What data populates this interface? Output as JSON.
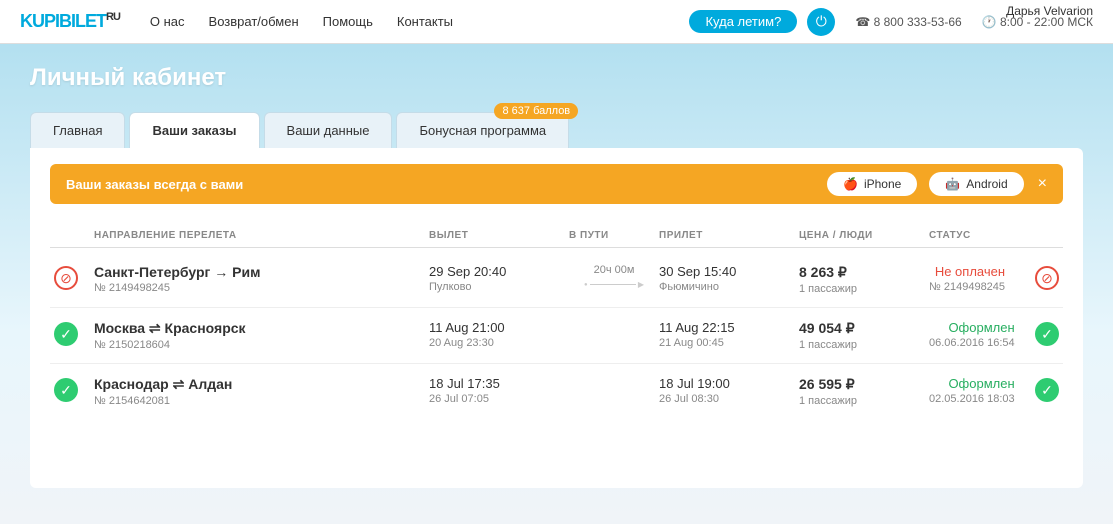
{
  "header": {
    "logo": "KUPIBILET",
    "logo_suffix": "RU",
    "nav": [
      "О нас",
      "Возврат/обмен",
      "Помощь",
      "Контакты"
    ],
    "search_placeholder": "Куда летим?",
    "phone": "8 800 333-53-66",
    "hours": "8:00 - 22:00 МСК",
    "user_name": "Дарья Velvarion"
  },
  "page": {
    "title": "Личный кабинет"
  },
  "tabs": [
    {
      "id": "main",
      "label": "Главная",
      "active": false
    },
    {
      "id": "orders",
      "label": "Ваши заказы",
      "active": true
    },
    {
      "id": "data",
      "label": "Ваши данные",
      "active": false
    },
    {
      "id": "bonus",
      "label": "Бонусная программа",
      "active": false,
      "badge": "8 637  баллов"
    }
  ],
  "app_banner": {
    "text": "Ваши заказы всегда с вами",
    "iphone_label": " iPhone",
    "android_label": " Android",
    "close": "×"
  },
  "table": {
    "columns": [
      "",
      "НАПРАВЛЕНИЕ ПЕРЕЛЕТА",
      "ВЫЛЕТ",
      "В ПУТИ",
      "ПРИЛЕТ",
      "ЦЕНА / ЛЮДИ",
      "СТАТУС"
    ],
    "orders": [
      {
        "status_icon": "cancel",
        "route": "Санкт-Петербург → Рим",
        "order_num": "№ 2149498245",
        "depart_time": "29 Sep 20:40",
        "depart_place": "Пулково",
        "duration": "20ч 00м",
        "arrive_time": "30 Sep 15:40",
        "arrive_place": "Фьюмичино",
        "price": "8 263 ₽",
        "passengers": "1 пассажир",
        "status_text": "Не оплачен",
        "status_type": "not-paid",
        "status_order": "№ 2149498245",
        "status_date": "",
        "status_icon_right": "cancel"
      },
      {
        "status_icon": "ok",
        "route": "Москва ⇌ Красноярск",
        "order_num": "№ 2150218604",
        "depart_time": "11 Aug 21:00",
        "depart_time2": "20 Aug 23:30",
        "depart_place": "",
        "duration": "",
        "arrive_time": "11 Aug 22:15",
        "arrive_time2": "21 Aug 00:45",
        "arrive_place": "",
        "price": "49 054 ₽",
        "passengers": "1 пассажир",
        "status_text": "Оформлен",
        "status_type": "paid",
        "status_order": "",
        "status_date": "06.06.2016 16:54",
        "status_icon_right": "ok"
      },
      {
        "status_icon": "ok",
        "route": "Краснодар ⇌ Алдан",
        "order_num": "№ 2154642081",
        "depart_time": "18 Jul 17:35",
        "depart_time2": "26 Jul 07:05",
        "depart_place": "",
        "duration": "",
        "arrive_time": "18 Jul 19:00",
        "arrive_time2": "26 Jul 08:30",
        "arrive_place": "",
        "price": "26 595 ₽",
        "passengers": "1 пассажир",
        "status_text": "Оформлен",
        "status_type": "paid",
        "status_order": "",
        "status_date": "02.05.2016 18:03",
        "status_icon_right": "ok"
      }
    ]
  }
}
